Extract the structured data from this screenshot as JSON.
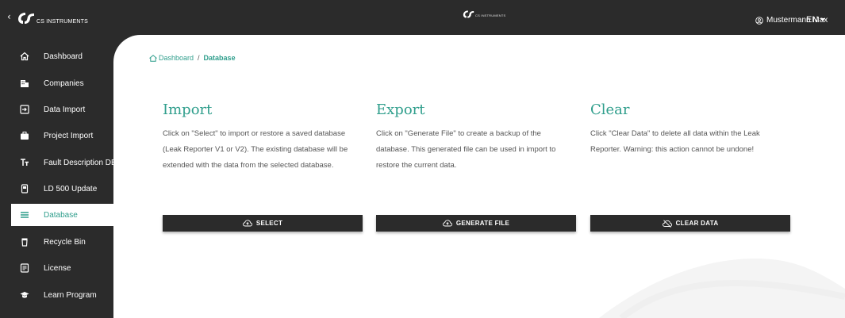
{
  "header": {
    "back_icon": "chevron-left-icon",
    "brand": "CS INSTRUMENTS",
    "center_brand": "CS INSTRUMENTS",
    "user_name": "Mustermann Max",
    "user_icon": "user-circle-icon",
    "language": "EN"
  },
  "sidebar": {
    "items": [
      {
        "label": "Dashboard",
        "icon": "home-icon"
      },
      {
        "label": "Companies",
        "icon": "building-icon"
      },
      {
        "label": "Data Import",
        "icon": "import-icon"
      },
      {
        "label": "Project Import",
        "icon": "briefcase-icon"
      },
      {
        "label": "Fault Description DB",
        "icon": "text-icon"
      },
      {
        "label": "LD 500 Update",
        "icon": "device-icon"
      },
      {
        "label": "Database",
        "icon": "list-icon",
        "active": true
      },
      {
        "label": "Recycle Bin",
        "icon": "trash-icon"
      },
      {
        "label": "License",
        "icon": "license-icon"
      },
      {
        "label": "Learn Program",
        "icon": "graduation-cap-icon"
      }
    ]
  },
  "breadcrumb": {
    "home": "Dashboard",
    "separator": "/",
    "current": "Database"
  },
  "sections": {
    "import": {
      "title": "Import",
      "description": "Click on \"Select\" to import or restore a saved database (Leak Reporter V1 or V2). The existing database will be extended with the data from the selected database.",
      "button": "SELECT"
    },
    "export": {
      "title": "Export",
      "description": "Click on \"Generate File\" to create a backup of the database. This generated file can be used in import to restore the current data.",
      "button": "GENERATE FILE"
    },
    "clear": {
      "title": "Clear",
      "description": "Click \"Clear Data\" to delete all data within the Leak Reporter. Warning: this action cannot be undone!",
      "button": "CLEAR DATA"
    }
  },
  "colors": {
    "accent": "#2f9e8c",
    "dark": "#2b2b2b",
    "text": "#555555"
  }
}
